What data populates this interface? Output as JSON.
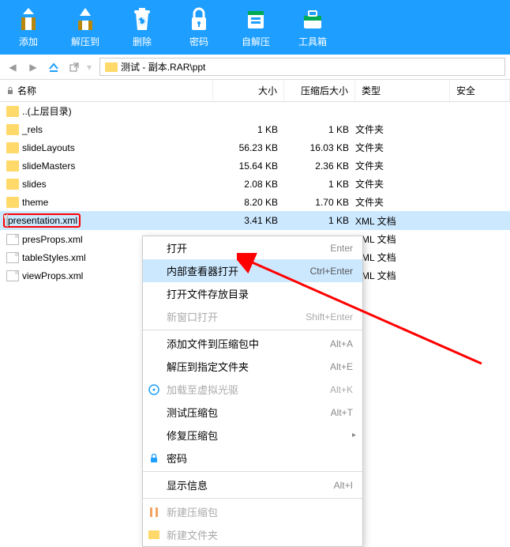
{
  "toolbar": {
    "add": "添加",
    "extract": "解压到",
    "delete": "删除",
    "password": "密码",
    "sfx": "自解压",
    "tools": "工具箱"
  },
  "path": "测试 - 副本.RAR\\ppt",
  "headers": {
    "name": "名称",
    "size": "大小",
    "csize": "压缩后大小",
    "type": "类型",
    "safe": "安全"
  },
  "files": [
    {
      "name": "..(上层目录)",
      "icon": "folder",
      "size": "",
      "csize": "",
      "type": ""
    },
    {
      "name": "_rels",
      "icon": "folder",
      "size": "1 KB",
      "csize": "1 KB",
      "type": "文件夹"
    },
    {
      "name": "slideLayouts",
      "icon": "folder",
      "size": "56.23 KB",
      "csize": "16.03 KB",
      "type": "文件夹"
    },
    {
      "name": "slideMasters",
      "icon": "folder",
      "size": "15.64 KB",
      "csize": "2.36 KB",
      "type": "文件夹"
    },
    {
      "name": "slides",
      "icon": "folder",
      "size": "2.08 KB",
      "csize": "1 KB",
      "type": "文件夹"
    },
    {
      "name": "theme",
      "icon": "folder",
      "size": "8.20 KB",
      "csize": "1.70 KB",
      "type": "文件夹"
    },
    {
      "name": "presentation.xml",
      "icon": "file",
      "size": "3.41 KB",
      "csize": "1 KB",
      "type": "XML 文档",
      "highlighted": true,
      "selected": true
    },
    {
      "name": "presProps.xml",
      "icon": "file",
      "size": "",
      "csize": "",
      "type": "XML 文档"
    },
    {
      "name": "tableStyles.xml",
      "icon": "file",
      "size": "",
      "csize": "",
      "type": "XML 文档"
    },
    {
      "name": "viewProps.xml",
      "icon": "file",
      "size": "",
      "csize": "",
      "type": "XML 文档"
    }
  ],
  "menu": {
    "open": "打开",
    "open_sc": "Enter",
    "internal": "内部查看器打开",
    "internal_sc": "Ctrl+Enter",
    "openloc": "打开文件存放目录",
    "newwin": "新窗口打开",
    "newwin_sc": "Shift+Enter",
    "addto": "添加文件到压缩包中",
    "addto_sc": "Alt+A",
    "extractto": "解压到指定文件夹",
    "extractto_sc": "Alt+E",
    "virtual": "加载至虚拟光驱",
    "virtual_sc": "Alt+K",
    "test": "测试压缩包",
    "test_sc": "Alt+T",
    "repair": "修复压缩包",
    "pass": "密码",
    "info": "显示信息",
    "info_sc": "Alt+I",
    "newarch": "新建压缩包",
    "newfolder": "新建文件夹"
  }
}
